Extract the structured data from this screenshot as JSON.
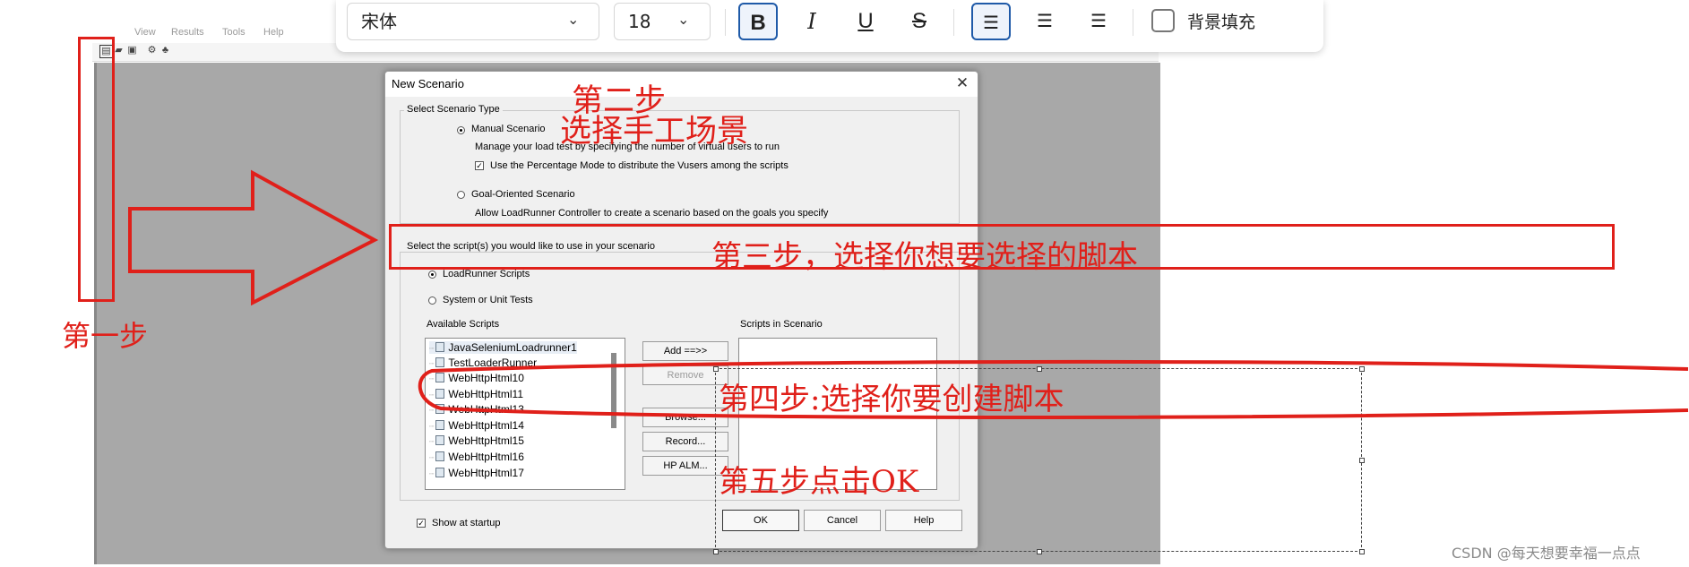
{
  "menu": {
    "items": [
      "View",
      "Results",
      "Tools",
      "Help"
    ]
  },
  "format_toolbar": {
    "font_name": "宋体",
    "font_size": "18",
    "bold": "B",
    "italic": "I",
    "underline": "U",
    "strike": "S",
    "fill_label": "背景填充",
    "active_color": "#1f5aa8"
  },
  "dialog": {
    "title": "New Scenario",
    "scenario_type": {
      "legend": "Select Scenario Type",
      "manual": {
        "label": "Manual Scenario",
        "desc": "Manage your load test by specifying the number of virtual users to run",
        "percentage_mode": "Use the Percentage Mode to distribute the Vusers among the scripts"
      },
      "goal": {
        "label": "Goal-Oriented Scenario",
        "desc": "Allow LoadRunner Controller to create a scenario based on the goals you specify"
      }
    },
    "scripts": {
      "legend": "Select the script(s) you would like to use in your scenario",
      "lr_scripts": "LoadRunner Scripts",
      "system_tests": "System or Unit Tests",
      "available_label": "Available Scripts",
      "in_scenario_label": "Scripts in Scenario",
      "available": [
        "JavaSeleniumLoadrunner1",
        "TestLoaderRunner",
        "WebHttpHtml10",
        "WebHttpHtml11",
        "WebHttpHtml13",
        "WebHttpHtml14",
        "WebHttpHtml15",
        "WebHttpHtml16",
        "WebHttpHtml17"
      ],
      "buttons": {
        "add": "Add ==>>",
        "remove": "Remove",
        "browse": "Browse...",
        "record": "Record...",
        "hp_alm": "HP ALM..."
      }
    },
    "show_at_startup": "Show at startup",
    "ok": "OK",
    "cancel": "Cancel",
    "help": "Help"
  },
  "annotations": {
    "step1": "第一步",
    "step2_a": "第二步",
    "step2_b": "选择手工场景",
    "step3": "第三步，选择你想要选择的脚本",
    "step4": "第四步:选择你要创建脚本",
    "step5": "第五步点击OK",
    "color": "#e0201a"
  },
  "watermark": "CSDN @每天想要幸福一点点"
}
